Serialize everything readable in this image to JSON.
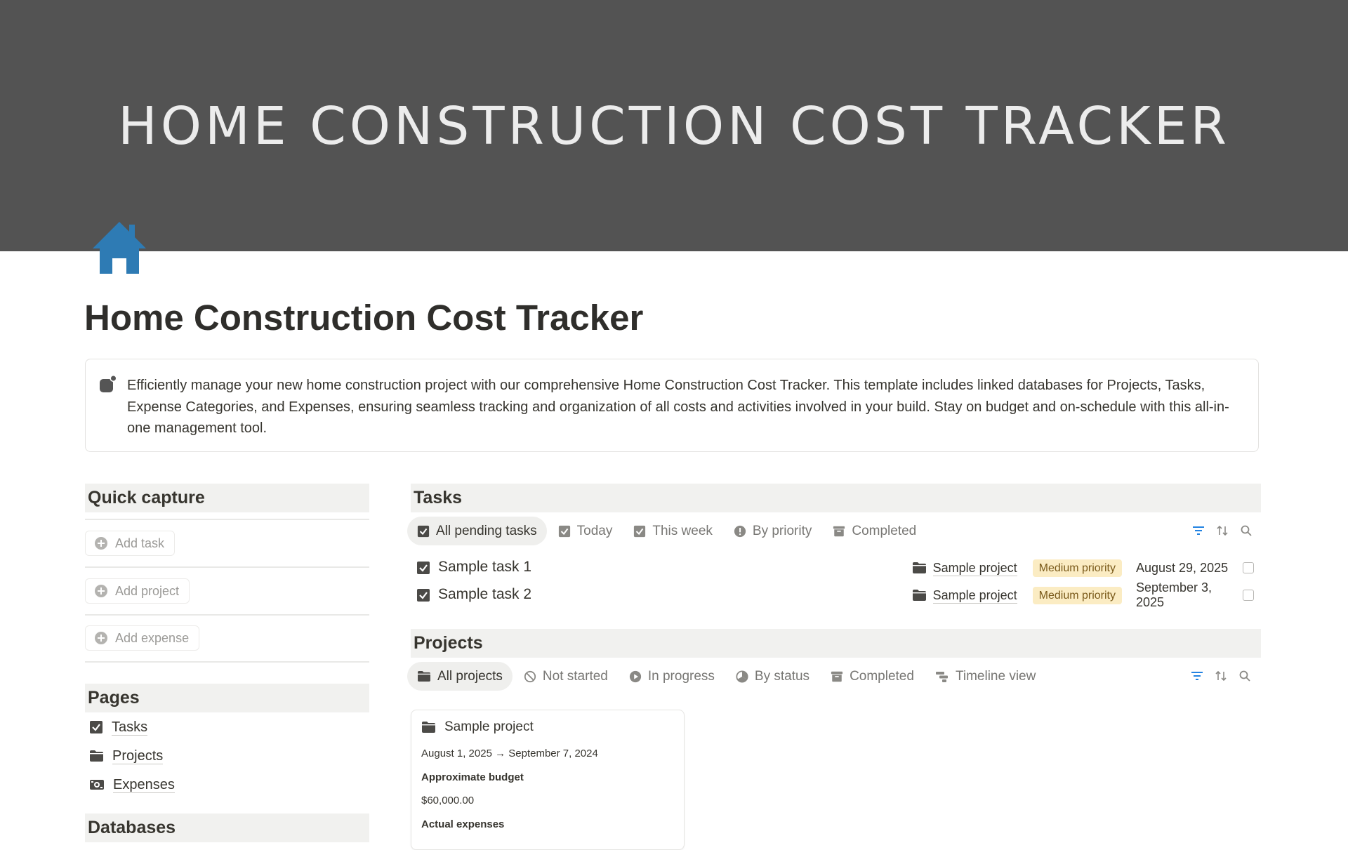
{
  "cover": {
    "text": "HOME CONSTRUCTION COST TRACKER"
  },
  "page": {
    "title": "Home Construction Cost Tracker",
    "icon": "house-icon"
  },
  "callout": {
    "icon": "callout-bullet-icon",
    "text": "Efficiently manage your new home construction project with our comprehensive Home Construction Cost Tracker. This template includes linked databases for Projects, Tasks, Expense Categories, and Expenses, ensuring seamless tracking and organization of all costs and activities involved in your build. Stay on budget and on-schedule with this all-in-one management tool."
  },
  "quick_capture": {
    "title": "Quick capture",
    "buttons": [
      {
        "label": "Add task",
        "icon": "plus-circle-icon"
      },
      {
        "label": "Add project",
        "icon": "plus-circle-icon"
      },
      {
        "label": "Add expense",
        "icon": "plus-circle-icon"
      }
    ]
  },
  "pages": {
    "title": "Pages",
    "items": [
      {
        "label": "Tasks",
        "icon": "checkbox-icon"
      },
      {
        "label": "Projects",
        "icon": "folder-icon"
      },
      {
        "label": "Expenses",
        "icon": "money-icon"
      }
    ]
  },
  "databases": {
    "title": "Databases"
  },
  "tasks": {
    "title": "Tasks",
    "tabs": [
      {
        "label": "All pending tasks",
        "icon": "checkbox-icon",
        "active": true
      },
      {
        "label": "Today",
        "icon": "checkbox-icon"
      },
      {
        "label": "This week",
        "icon": "checkbox-icon"
      },
      {
        "label": "By priority",
        "icon": "alert-icon"
      },
      {
        "label": "Completed",
        "icon": "archive-icon"
      }
    ],
    "rows": [
      {
        "name": "Sample task 1",
        "project": "Sample project",
        "priority": "Medium priority",
        "date": "August 29, 2025",
        "done": false
      },
      {
        "name": "Sample task 2",
        "project": "Sample project",
        "priority": "Medium priority",
        "date": "September 3, 2025",
        "done": false
      }
    ]
  },
  "projects": {
    "title": "Projects",
    "tabs": [
      {
        "label": "All projects",
        "icon": "folder-icon",
        "active": true
      },
      {
        "label": "Not started",
        "icon": "blocked-icon"
      },
      {
        "label": "In progress",
        "icon": "play-icon"
      },
      {
        "label": "By status",
        "icon": "status-icon"
      },
      {
        "label": "Completed",
        "icon": "archive-icon"
      },
      {
        "label": "Timeline view",
        "icon": "timeline-icon"
      }
    ],
    "cards": [
      {
        "title": "Sample project",
        "dates": "August 1, 2025 → September 7, 2024",
        "budget_label": "Approximate budget",
        "budget_value": "$60,000.00",
        "expenses_label": "Actual expenses"
      }
    ]
  },
  "colors": {
    "accent": "#2383e2",
    "cover": "#535353",
    "house": "#2e7bb4",
    "badge_bg": "#fbecc3"
  }
}
